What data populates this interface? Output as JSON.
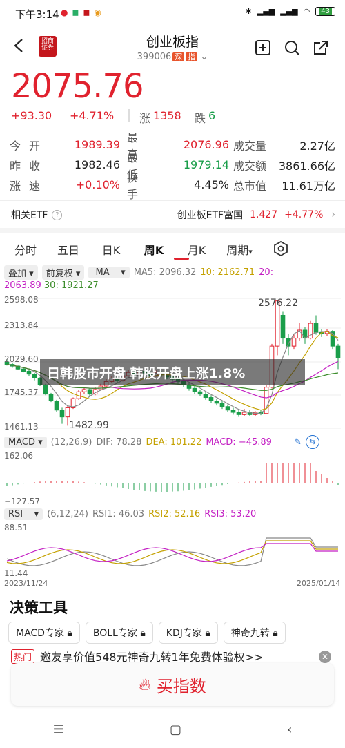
{
  "status_bar": {
    "time": "下午3:14",
    "battery": "43"
  },
  "header": {
    "logo_text": "招商\n证券",
    "title": "创业板指",
    "code": "399006",
    "tag_market": "深",
    "tag_index": "指"
  },
  "quote": {
    "price": "2075.76",
    "change": "+93.30",
    "change_pct": "+4.71%",
    "up_label": "涨",
    "up_count": "1358",
    "down_label": "跌",
    "down_count": "6"
  },
  "stats": [
    [
      {
        "label": "今开",
        "value": "1989.39",
        "color": "red"
      },
      {
        "label": "最高",
        "value": "2076.96",
        "color": "red"
      },
      {
        "label": "成交量",
        "value": "2.27亿",
        "color": "black"
      }
    ],
    [
      {
        "label": "昨收",
        "value": "1982.46",
        "color": "black"
      },
      {
        "label": "最低",
        "value": "1979.14",
        "color": "green"
      },
      {
        "label": "成交额",
        "value": "3861.66亿",
        "color": "black"
      }
    ],
    [
      {
        "label": "涨速",
        "value": "+0.10%",
        "color": "red"
      },
      {
        "label": "换手",
        "value": "4.45%",
        "color": "black"
      },
      {
        "label": "总市值",
        "value": "11.61万亿",
        "color": "black"
      }
    ]
  ],
  "etf": {
    "label": "相关ETF",
    "name": "创业板ETF富国",
    "price": "1.427",
    "change": "+4.77%"
  },
  "tabs": [
    "分时",
    "五日",
    "日K",
    "周K",
    "月K",
    "周期"
  ],
  "active_tab": "周K",
  "indicators": {
    "overlay": "叠加",
    "adjust": "前复权",
    "ma": "MA",
    "ma5": "MA5: 2096.32",
    "ma10": "10: 2162.71",
    "ma20": "20:",
    "ma20_val": "2063.89",
    "ma30": "30: 1921.27",
    "macd_name": "MACD",
    "macd_params": "(12,26,9)",
    "dif": "DIF: 78.28",
    "dea": "DEA: 101.22",
    "macd_val": "MACD: −45.89",
    "rsi_name": "RSI",
    "rsi_params": "(6,12,24)",
    "rsi1": "RSI1: 46.03",
    "rsi2": "RSI2: 52.16",
    "rsi3": "RSI3: 53.20"
  },
  "kchart_axis": {
    "y_top": "2598.08",
    "y_2": "2313.84",
    "y_3": "2029.60",
    "y_4": "1745.37",
    "y_bottom": "1461.13",
    "high_label": "2576.22",
    "low_label": "1482.99"
  },
  "macd_axis": {
    "top": "162.06",
    "bottom": "−127.57"
  },
  "rsi_axis": {
    "top": "88.51",
    "bottom": "11.44",
    "date_start": "2023/11/24",
    "date_end": "2025/01/14"
  },
  "overlay_headline": "日韩股市开盘 韩股开盘上涨1.8%",
  "decision": {
    "title": "决策工具",
    "tools": [
      "MACD专家",
      "BOLL专家",
      "KDJ专家",
      "神奇九转"
    ]
  },
  "promo": {
    "tag": "热门",
    "text": "邀友享价值548元神奇九转1年免费体验权>>"
  },
  "buy": {
    "label": "买指数"
  },
  "colors": {
    "up": "#e0222e",
    "down": "#1a9e4a",
    "accent": "#e0222e"
  },
  "chart_data": {
    "type": "candlestick",
    "candles": [
      [
        2040,
        2020,
        2065,
        2010
      ],
      [
        2020,
        2005,
        2030,
        1990
      ],
      [
        2005,
        1980,
        2010,
        1970
      ],
      [
        1980,
        1960,
        1990,
        1950
      ],
      [
        1960,
        1935,
        1970,
        1920
      ],
      [
        1935,
        1900,
        1945,
        1880
      ],
      [
        1900,
        1840,
        1910,
        1830
      ],
      [
        1840,
        1760,
        1850,
        1750
      ],
      [
        1760,
        1700,
        1770,
        1690
      ],
      [
        1700,
        1620,
        1710,
        1600
      ],
      [
        1620,
        1560,
        1640,
        1500
      ],
      [
        1560,
        1640,
        1660,
        1483
      ],
      [
        1640,
        1720,
        1730,
        1630
      ],
      [
        1720,
        1780,
        1800,
        1710
      ],
      [
        1780,
        1800,
        1820,
        1760
      ],
      [
        1800,
        1760,
        1810,
        1740
      ],
      [
        1760,
        1800,
        1820,
        1750
      ],
      [
        1800,
        1830,
        1850,
        1790
      ],
      [
        1830,
        1870,
        1890,
        1820
      ],
      [
        1870,
        1900,
        1920,
        1860
      ],
      [
        1900,
        1880,
        1920,
        1860
      ],
      [
        1880,
        1920,
        1940,
        1870
      ],
      [
        1920,
        1950,
        1970,
        1910
      ],
      [
        1950,
        1930,
        1970,
        1910
      ],
      [
        1930,
        1960,
        1980,
        1920
      ],
      [
        1960,
        1940,
        1980,
        1930
      ],
      [
        1940,
        1920,
        1960,
        1900
      ],
      [
        1920,
        1950,
        1970,
        1910
      ],
      [
        1950,
        1930,
        1960,
        1910
      ],
      [
        1930,
        1910,
        1950,
        1890
      ],
      [
        1910,
        1890,
        1930,
        1870
      ],
      [
        1890,
        1870,
        1910,
        1850
      ],
      [
        1870,
        1840,
        1890,
        1820
      ],
      [
        1840,
        1810,
        1860,
        1790
      ],
      [
        1810,
        1780,
        1830,
        1760
      ],
      [
        1780,
        1760,
        1800,
        1740
      ],
      [
        1760,
        1730,
        1780,
        1710
      ],
      [
        1730,
        1700,
        1750,
        1680
      ],
      [
        1700,
        1680,
        1720,
        1660
      ],
      [
        1680,
        1650,
        1700,
        1630
      ],
      [
        1650,
        1620,
        1670,
        1600
      ],
      [
        1620,
        1600,
        1640,
        1580
      ],
      [
        1600,
        1580,
        1620,
        1560
      ],
      [
        1580,
        1600,
        1630,
        1570
      ],
      [
        1600,
        1580,
        1620,
        1570
      ],
      [
        1580,
        1600,
        1610,
        1570
      ],
      [
        1600,
        1590,
        1620,
        1575
      ],
      [
        1590,
        1820,
        1840,
        1585
      ],
      [
        1820,
        2180,
        2200,
        1810
      ],
      [
        2180,
        2576,
        2576,
        2100
      ],
      [
        2450,
        2250,
        2480,
        2200
      ],
      [
        2250,
        2180,
        2290,
        2100
      ],
      [
        2180,
        2250,
        2290,
        2150
      ],
      [
        2250,
        2320,
        2380,
        2230
      ],
      [
        2320,
        2250,
        2350,
        2200
      ],
      [
        2250,
        2380,
        2400,
        2240
      ],
      [
        2380,
        2300,
        2450,
        2280
      ],
      [
        2300,
        2290,
        2330,
        2260
      ],
      [
        2290,
        2310,
        2330,
        2270
      ],
      [
        2310,
        2180,
        2320,
        2150
      ],
      [
        2180,
        2076,
        2200,
        1979
      ]
    ],
    "ylim": [
      1461.13,
      2598.08
    ],
    "x_start": "2023/11/24",
    "x_end": "2025/01/14"
  }
}
